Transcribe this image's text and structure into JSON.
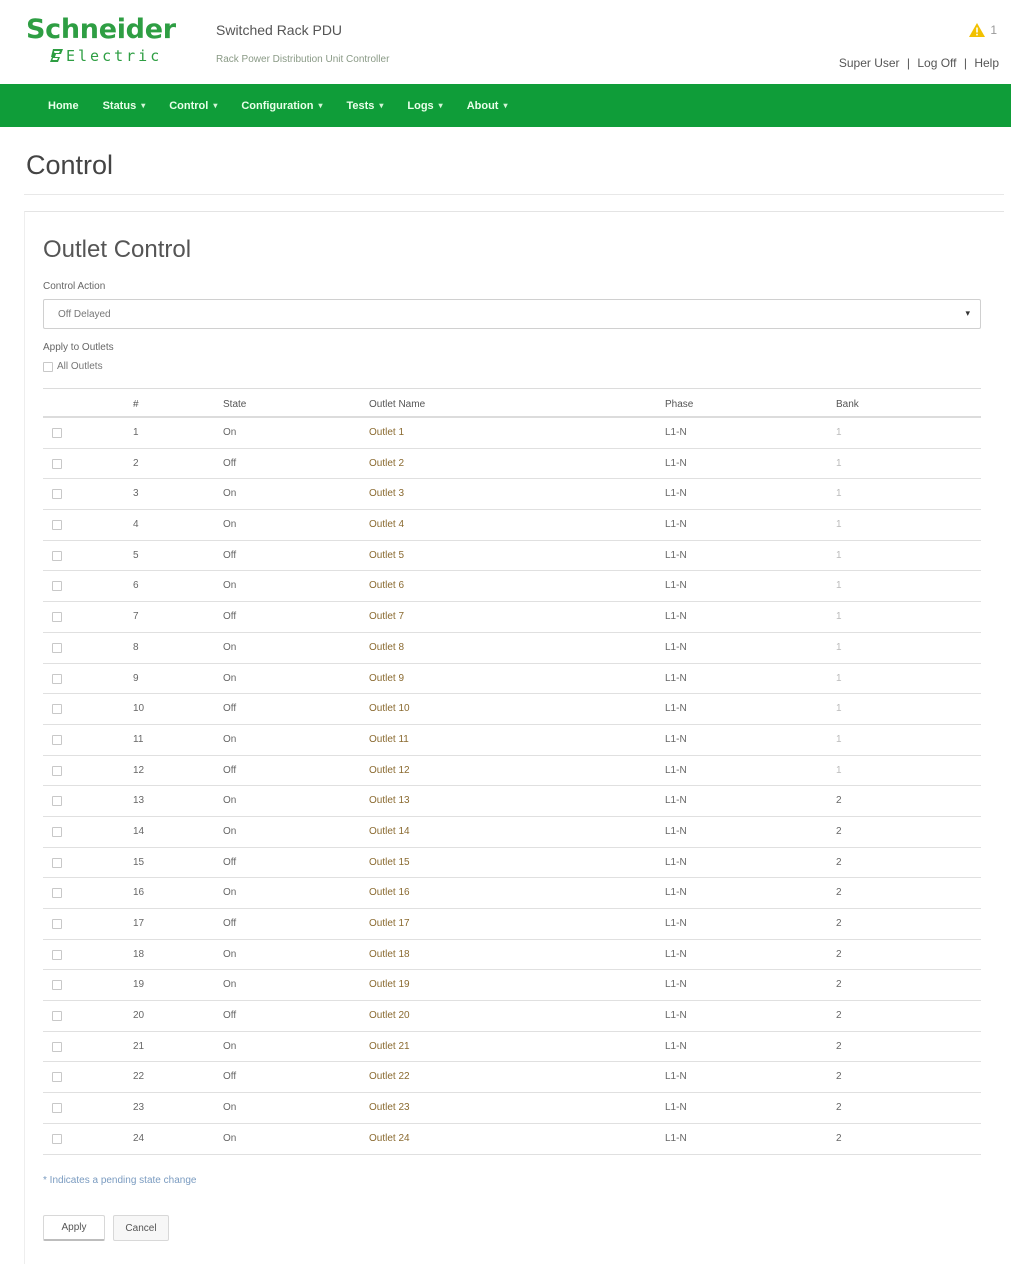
{
  "header": {
    "logo_top": "Schneider",
    "logo_bottom": "Electric",
    "device_title": "Switched Rack PDU",
    "device_subtitle": "Rack Power Distribution Unit Controller",
    "alarm_count": "1",
    "user_links": [
      "Super User",
      "Log Off",
      "Help"
    ],
    "user_link_seps": [
      "|",
      "|"
    ],
    "brand_color": "#2e9e43",
    "nav_color": "#0f9d39",
    "alarm_color": "#f2c100"
  },
  "nav": [
    {
      "label": "Home",
      "dropdown": false
    },
    {
      "label": "Status",
      "dropdown": true
    },
    {
      "label": "Control",
      "dropdown": true
    },
    {
      "label": "Configuration",
      "dropdown": true
    },
    {
      "label": "Tests",
      "dropdown": true
    },
    {
      "label": "Logs",
      "dropdown": true
    },
    {
      "label": "About",
      "dropdown": true
    }
  ],
  "page": {
    "title": "Control",
    "panel_title": "Outlet Control",
    "control_action_label": "Control Action",
    "control_action_value": "Off Delayed",
    "apply_label": "Apply to Outlets",
    "all_outlets_label": "All Outlets",
    "legend": "* Indicates a pending state change",
    "apply_button": "Apply",
    "cancel_button": "Cancel"
  },
  "table": {
    "headers": [
      "#",
      "State",
      "Outlet Name",
      "Phase",
      "Bank"
    ],
    "rows": [
      {
        "num": "1",
        "state": "On",
        "name": "Outlet 1",
        "phase": "L1-N",
        "bank": "1"
      },
      {
        "num": "2",
        "state": "Off",
        "name": "Outlet 2",
        "phase": "L1-N",
        "bank": "1"
      },
      {
        "num": "3",
        "state": "On",
        "name": "Outlet 3",
        "phase": "L1-N",
        "bank": "1"
      },
      {
        "num": "4",
        "state": "On",
        "name": "Outlet 4",
        "phase": "L1-N",
        "bank": "1"
      },
      {
        "num": "5",
        "state": "Off",
        "name": "Outlet 5",
        "phase": "L1-N",
        "bank": "1"
      },
      {
        "num": "6",
        "state": "On",
        "name": "Outlet 6",
        "phase": "L1-N",
        "bank": "1"
      },
      {
        "num": "7",
        "state": "Off",
        "name": "Outlet 7",
        "phase": "L1-N",
        "bank": "1"
      },
      {
        "num": "8",
        "state": "On",
        "name": "Outlet 8",
        "phase": "L1-N",
        "bank": "1"
      },
      {
        "num": "9",
        "state": "On",
        "name": "Outlet 9",
        "phase": "L1-N",
        "bank": "1"
      },
      {
        "num": "10",
        "state": "Off",
        "name": "Outlet 10",
        "phase": "L1-N",
        "bank": "1"
      },
      {
        "num": "11",
        "state": "On",
        "name": "Outlet 11",
        "phase": "L1-N",
        "bank": "1"
      },
      {
        "num": "12",
        "state": "Off",
        "name": "Outlet 12",
        "phase": "L1-N",
        "bank": "1"
      },
      {
        "num": "13",
        "state": "On",
        "name": "Outlet 13",
        "phase": "L1-N",
        "bank": "2"
      },
      {
        "num": "14",
        "state": "On",
        "name": "Outlet 14",
        "phase": "L1-N",
        "bank": "2"
      },
      {
        "num": "15",
        "state": "Off",
        "name": "Outlet 15",
        "phase": "L1-N",
        "bank": "2"
      },
      {
        "num": "16",
        "state": "On",
        "name": "Outlet 16",
        "phase": "L1-N",
        "bank": "2"
      },
      {
        "num": "17",
        "state": "Off",
        "name": "Outlet 17",
        "phase": "L1-N",
        "bank": "2"
      },
      {
        "num": "18",
        "state": "On",
        "name": "Outlet 18",
        "phase": "L1-N",
        "bank": "2"
      },
      {
        "num": "19",
        "state": "On",
        "name": "Outlet 19",
        "phase": "L1-N",
        "bank": "2"
      },
      {
        "num": "20",
        "state": "Off",
        "name": "Outlet 20",
        "phase": "L1-N",
        "bank": "2"
      },
      {
        "num": "21",
        "state": "On",
        "name": "Outlet 21",
        "phase": "L1-N",
        "bank": "2"
      },
      {
        "num": "22",
        "state": "Off",
        "name": "Outlet 22",
        "phase": "L1-N",
        "bank": "2"
      },
      {
        "num": "23",
        "state": "On",
        "name": "Outlet 23",
        "phase": "L1-N",
        "bank": "2"
      },
      {
        "num": "24",
        "state": "On",
        "name": "Outlet 24",
        "phase": "L1-N",
        "bank": "2"
      }
    ]
  }
}
